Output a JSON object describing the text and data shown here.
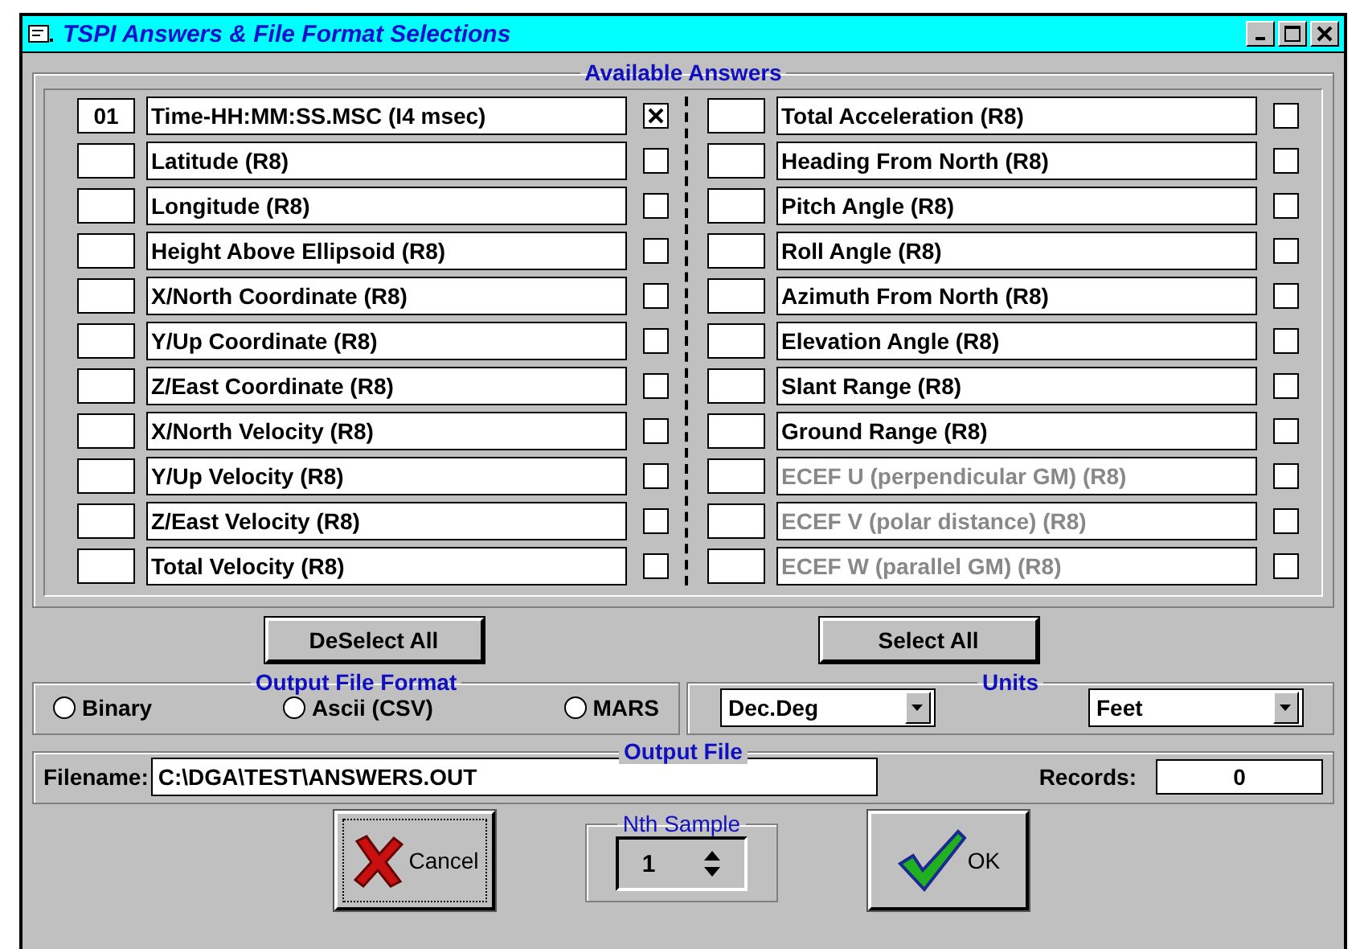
{
  "window": {
    "title": "TSPI Answers & File Format Selections"
  },
  "answers": {
    "title": "Available Answers",
    "left": [
      {
        "index": "01",
        "label": "Time-HH:MM:SS.MSC (I4 msec)",
        "checked": true,
        "disabled": false
      },
      {
        "label": "Latitude (R8)",
        "checked": false,
        "disabled": false
      },
      {
        "label": "Longitude (R8)",
        "checked": false,
        "disabled": false
      },
      {
        "label": "Height Above Ellipsoid (R8)",
        "checked": false,
        "disabled": false
      },
      {
        "label": "X/North Coordinate (R8)",
        "checked": false,
        "disabled": false
      },
      {
        "label": "Y/Up Coordinate (R8)",
        "checked": false,
        "disabled": false
      },
      {
        "label": "Z/East Coordinate (R8)",
        "checked": false,
        "disabled": false
      },
      {
        "label": "X/North Velocity (R8)",
        "checked": false,
        "disabled": false
      },
      {
        "label": "Y/Up Velocity (R8)",
        "checked": false,
        "disabled": false
      },
      {
        "label": "Z/East Velocity (R8)",
        "checked": false,
        "disabled": false
      },
      {
        "label": "Total Velocity (R8)",
        "checked": false,
        "disabled": false
      }
    ],
    "right": [
      {
        "label": "Total Acceleration (R8)",
        "checked": false,
        "disabled": false
      },
      {
        "label": "Heading From North (R8)",
        "checked": false,
        "disabled": false
      },
      {
        "label": "Pitch Angle (R8)",
        "checked": false,
        "disabled": false
      },
      {
        "label": "Roll Angle (R8)",
        "checked": false,
        "disabled": false
      },
      {
        "label": "Azimuth From North (R8)",
        "checked": false,
        "disabled": false
      },
      {
        "label": "Elevation Angle (R8)",
        "checked": false,
        "disabled": false
      },
      {
        "label": "Slant Range (R8)",
        "checked": false,
        "disabled": false
      },
      {
        "label": "Ground Range (R8)",
        "checked": false,
        "disabled": false
      },
      {
        "label": "ECEF U (perpendicular GM) (R8)",
        "checked": false,
        "disabled": true
      },
      {
        "label": "ECEF V (polar distance) (R8)",
        "checked": false,
        "disabled": true
      },
      {
        "label": "ECEF W (parallel GM) (R8)",
        "checked": false,
        "disabled": true
      }
    ]
  },
  "buttons": {
    "deselect_all": "DeSelect All",
    "select_all": "Select All"
  },
  "output_format": {
    "title": "Output File Format",
    "options": [
      {
        "label": "Binary",
        "selected": false
      },
      {
        "label": "Ascii (CSV)",
        "selected": false
      },
      {
        "label": "MARS",
        "selected": false
      }
    ]
  },
  "units": {
    "title": "Units",
    "dropdowns": [
      {
        "value": "Dec.Deg"
      },
      {
        "value": "Feet"
      }
    ]
  },
  "output_file": {
    "title": "Output File",
    "filename_label": "Filename:",
    "filename": "C:\\DGA\\TEST\\ANSWERS.OUT",
    "records_label": "Records:",
    "records": "0"
  },
  "nth_sample": {
    "title": "Nth Sample",
    "value": "1"
  },
  "cancel": "Cancel",
  "ok": "OK"
}
